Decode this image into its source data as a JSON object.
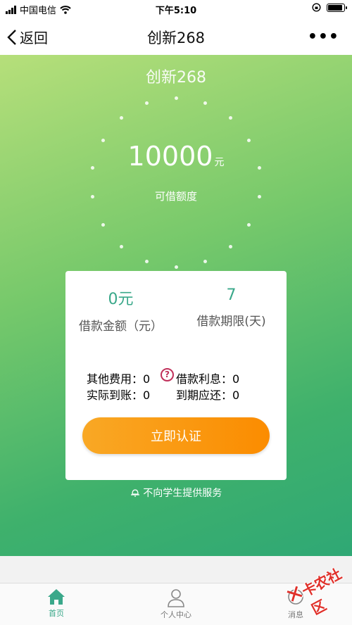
{
  "status_bar": {
    "carrier": "中国电信",
    "time": "下午5:10",
    "battery_level": 0.9
  },
  "nav": {
    "back_label": "返回",
    "title": "创新268",
    "more_label": "•••"
  },
  "hero": {
    "title": "创新268",
    "amount": "10000",
    "amount_unit": "元",
    "amount_label": "可借额度"
  },
  "card": {
    "loan_amount_value": "0元",
    "loan_amount_label": "借款金额（元）",
    "loan_term_value": "7",
    "loan_term_label": "借款期限(天)",
    "other_fees": "其他费用：0",
    "interest": "借款利息：0",
    "actual_received": "实际到账：0",
    "due_repayment": "到期应还：0",
    "help_icon_text": "?",
    "cta_label": "立即认证"
  },
  "notice": {
    "icon": "bell-icon",
    "text": "不向学生提供服务"
  },
  "tabs": [
    {
      "label": "首页",
      "icon": "home-icon",
      "active": true
    },
    {
      "label": "个人中心",
      "icon": "person-icon",
      "active": false
    },
    {
      "label": "消息",
      "icon": "message-icon",
      "active": false
    }
  ],
  "watermark": {
    "text": "卡农社区"
  },
  "colors": {
    "accent": "#3aa88a",
    "cta_start": "#f9a825",
    "cta_end": "#fb8c00",
    "help": "#c0305a"
  }
}
